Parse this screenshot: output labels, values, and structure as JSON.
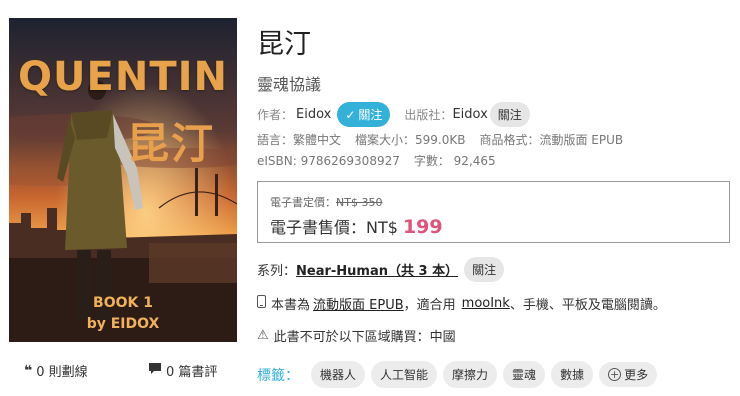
{
  "book": {
    "cover": {
      "title_en": "QUENTIN",
      "title_cn": "昆汀",
      "book_no": "BOOK 1",
      "by": "by EIDOX"
    },
    "title": "昆汀",
    "subtitle": "靈魂協議",
    "author_label": "作者：",
    "author": "Eidox",
    "author_follow": "關注",
    "publisher_label": "出版社：",
    "publisher": "Eidox",
    "publisher_follow": "關注",
    "language": "語言：繁體中文",
    "filesize": "檔案大小：599.0KB",
    "format": "商品格式：流動版面 EPUB",
    "eisbn": "eISBN: 9786269308927",
    "wordcount": "字數： 92,465"
  },
  "price": {
    "list_label": "電子書定價：",
    "list_value": "NT$ 350",
    "sale_label": "電子書售價：NT$",
    "sale_value": "199"
  },
  "series": {
    "label": "系列：",
    "name": "Near-Human（共 3 本）",
    "follow": "關注"
  },
  "format_line": {
    "prefix": "本書為",
    "format_link": "流動版面 EPUB",
    "middle": "，適合用",
    "app_link": "mooInk",
    "suffix": "、手機、平板及電腦閱讀。"
  },
  "region_line": "此書不可於以下區域購買：中國",
  "stats": {
    "quotes": "0 則劃線",
    "reviews": "0 篇書評"
  },
  "tags": {
    "label": "標籤：",
    "items": [
      "機器人",
      "人工智能",
      "摩擦力",
      "靈魂",
      "數據"
    ],
    "more": "更多"
  },
  "colors": {
    "accent": "#33b1d8",
    "price": "#e0537a"
  }
}
